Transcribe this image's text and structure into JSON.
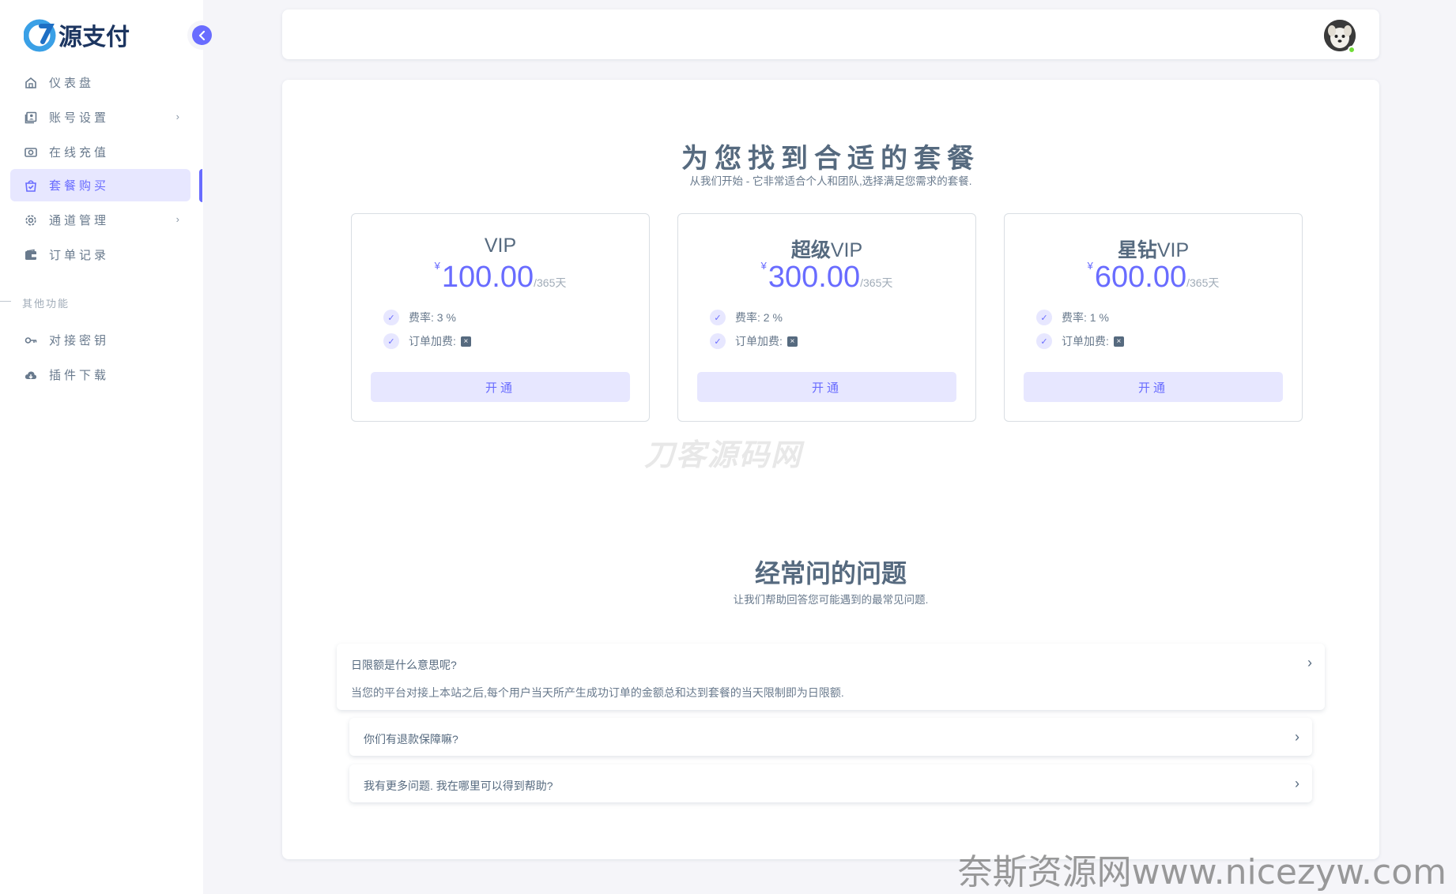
{
  "sidebar": {
    "logo_text": "源支付",
    "items": [
      {
        "label": "仪表盘",
        "icon": "home-icon",
        "has_arrow": false
      },
      {
        "label": "账号设置",
        "icon": "user-card-icon",
        "has_arrow": true
      },
      {
        "label": "在线充值",
        "icon": "money-icon",
        "has_arrow": false
      },
      {
        "label": "套餐购买",
        "icon": "shopping-bag-icon",
        "has_arrow": false,
        "active": true
      },
      {
        "label": "通道管理",
        "icon": "gear-icon",
        "has_arrow": true
      },
      {
        "label": "订单记录",
        "icon": "wallet-icon",
        "has_arrow": false
      }
    ],
    "section_header": "其他功能",
    "items2": [
      {
        "label": "对接密钥",
        "icon": "key-icon"
      },
      {
        "label": "插件下载",
        "icon": "cloud-download-icon"
      }
    ]
  },
  "pricing": {
    "title": "为您找到合适的套餐",
    "subtitle": "从我们开始 - 它非常适合个人和团队,选择满足您需求的套餐.",
    "plans": [
      {
        "name_prefix": "",
        "name_suffix": "VIP",
        "currency": "¥",
        "price": "100.00",
        "period": "/365天",
        "rate_label": "费率:",
        "rate_value": "3 %",
        "fee_label": "订单加费:",
        "button": "开通"
      },
      {
        "name_prefix": "超级",
        "name_suffix": "VIP",
        "currency": "¥",
        "price": "300.00",
        "period": "/365天",
        "rate_label": "费率:",
        "rate_value": "2 %",
        "fee_label": "订单加费:",
        "button": "开通"
      },
      {
        "name_prefix": "星钻",
        "name_suffix": "VIP",
        "currency": "¥",
        "price": "600.00",
        "period": "/365天",
        "rate_label": "费率:",
        "rate_value": "1 %",
        "fee_label": "订单加费:",
        "button": "开通"
      }
    ]
  },
  "faq": {
    "title": "经常问的问题",
    "subtitle": "让我们帮助回答您可能遇到的最常见问题.",
    "items": [
      {
        "question": "日限额是什么意思呢?",
        "answer": "当您的平台对接上本站之后,每个用户当天所产生成功订单的金额总和达到套餐的当天限制即为日限额."
      },
      {
        "question": "你们有退款保障嘛?"
      },
      {
        "question": "我有更多问题. 我在哪里可以得到帮助?"
      }
    ]
  },
  "watermarks": {
    "center": "刀客源码网",
    "corner": "奈斯资源网www.nicezyw.com"
  },
  "colors": {
    "accent": "#696cff",
    "accent_light": "#e7e7ff",
    "text": "#566a7f",
    "background": "#f5f5f9"
  }
}
